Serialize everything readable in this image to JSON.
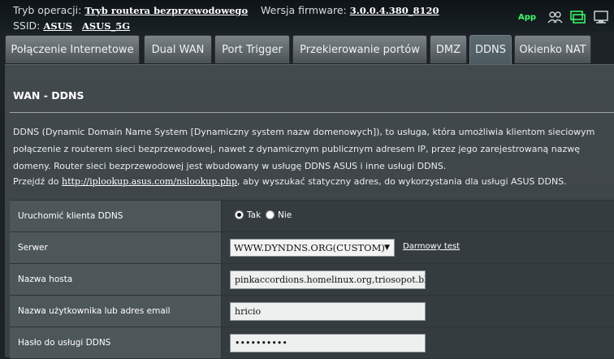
{
  "header": {
    "mode_label": "Tryb operacji:",
    "mode_value": "Tryb routera bezprzewodowego",
    "firmware_label": "Wersja firmware:",
    "firmware_value": "3.0.0.4.380_8120",
    "ssid_label": "SSID:",
    "ssid_values": [
      "ASUS",
      "ASUS_5G"
    ],
    "app_label": "App"
  },
  "tabs": [
    {
      "label": "Połączenie Internetowe"
    },
    {
      "label": "Dual WAN"
    },
    {
      "label": "Port Trigger"
    },
    {
      "label": "Przekierowanie portów"
    },
    {
      "label": "DMZ"
    },
    {
      "label": "DDNS",
      "active": true
    },
    {
      "label": "Okienko NAT"
    }
  ],
  "page": {
    "title": "WAN - DDNS",
    "description": "DDNS (Dynamic Domain Name System [Dynamiczny system nazw domenowych]), to usługa, która umożliwia klientom sieciowym połączenie z routerem sieci bezprzewodowej, nawet z dynamicznym publicznym adresem IP, przez jego zarejestrowaną nazwę domeny. Router sieci bezprzewodowej jest wbudowany w usługę DDNS ASUS i inne usługi DDNS.",
    "hint_prefix": "Przejdź do",
    "hint_link": "http://iplookup.asus.com/nslookup.php",
    "hint_suffix": ", aby wyszukać statyczny adres, do wykorzystania dla usługi ASUS DDNS."
  },
  "form": {
    "enable_label": "Uruchomić klienta DDNS",
    "enable_yes": "Tak",
    "enable_no": "Nie",
    "enable_value": "Tak",
    "server_label": "Serwer",
    "server_value": "WWW.DYNDNS.ORG(CUSTOM)",
    "free_test_link": "Darmowy test",
    "host_label": "Nazwa hosta",
    "host_value": "pinkaccordions.homelinux.org,triosopot.blogsite.org",
    "user_label": "Nazwa użytkownika lub adres email",
    "user_value": "hricio",
    "pass_label": "Hasło do usługi DDNS",
    "pass_value": "••••••••••"
  }
}
